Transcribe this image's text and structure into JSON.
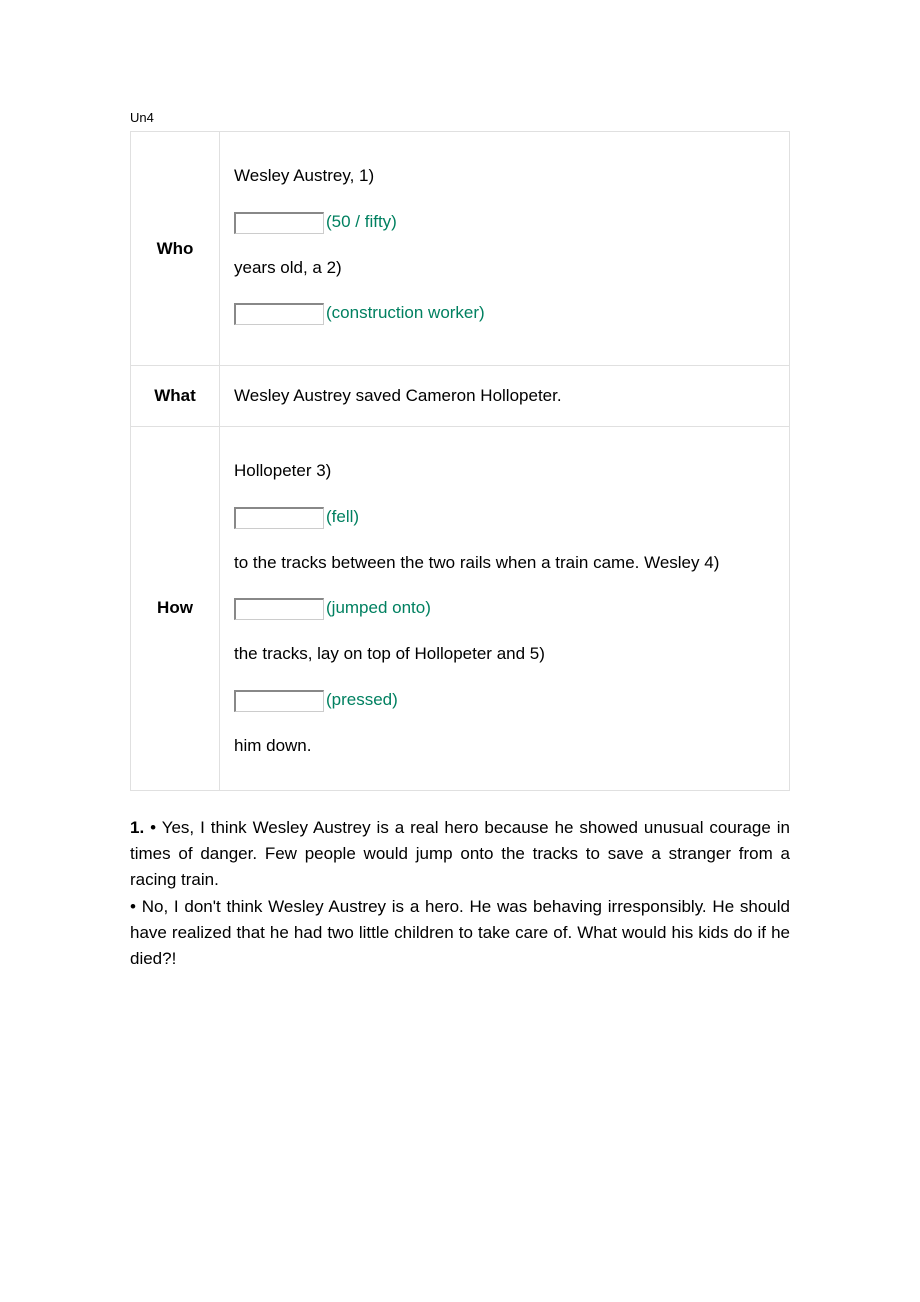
{
  "header": "Un4",
  "table": {
    "rows": [
      {
        "label": "Who",
        "segments": [
          {
            "type": "text",
            "value": "Wesley Austrey, 1)"
          },
          {
            "type": "input",
            "answer": "(50 / fifty)"
          },
          {
            "type": "text",
            "value": "years old, a 2)"
          },
          {
            "type": "input",
            "answer": "(construction worker)"
          }
        ]
      },
      {
        "label": "What",
        "segments": [
          {
            "type": "plain",
            "value": "Wesley Austrey saved Cameron Hollopeter."
          }
        ]
      },
      {
        "label": "How",
        "segments": [
          {
            "type": "text",
            "value": "Hollopeter 3)"
          },
          {
            "type": "input",
            "answer": "(fell)"
          },
          {
            "type": "text",
            "value": "to the tracks between the two rails when a train came. Wesley 4)"
          },
          {
            "type": "input",
            "answer": "(jumped onto)"
          },
          {
            "type": "text",
            "value": "the tracks, lay on top of Hollopeter and 5)"
          },
          {
            "type": "input",
            "answer": "(pressed)"
          },
          {
            "type": "text",
            "value": "him down."
          }
        ]
      }
    ]
  },
  "paragraph": {
    "num": "1.",
    "yes": "• Yes, I think Wesley Austrey is a real hero because he showed unusual courage in times of danger. Few people would jump onto the tracks to save a stranger from a racing train.",
    "no": "• No, I don't think Wesley Austrey is a hero. He was behaving irresponsibly. He should have realized that he had two little children to take care of. What would his kids do if he died?!"
  }
}
